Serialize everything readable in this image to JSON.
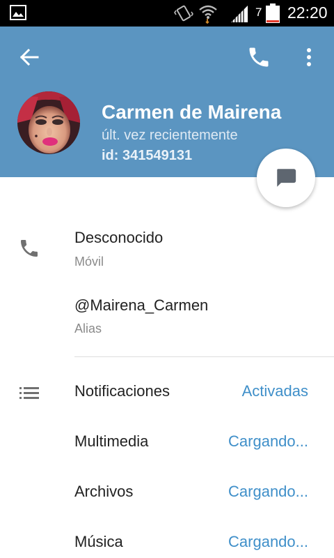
{
  "status_bar": {
    "battery_level": "7",
    "time": "22:20",
    "icons": [
      "gallery-icon",
      "vibrate-icon",
      "wifi-icon",
      "signal-icon",
      "battery-icon"
    ]
  },
  "header": {
    "name": "Carmen de Mairena",
    "status": "últ. vez recientemente",
    "id_text": "id: 341549131",
    "background_color": "#5b95c1",
    "icons": [
      "back-arrow-icon",
      "phone-icon",
      "more-vert-icon",
      "chat-icon"
    ]
  },
  "contact_info": {
    "phone": {
      "value": "Desconocido",
      "label": "Móvil",
      "icon": "phone-icon"
    },
    "username": {
      "value": "@Mairena_Carmen",
      "label": "Alias"
    }
  },
  "settings": {
    "icon": "list-icon",
    "accent_color": "#3f8fc9",
    "items": [
      {
        "label": "Notificaciones",
        "value": "Activadas"
      },
      {
        "label": "Multimedia",
        "value": "Cargando..."
      },
      {
        "label": "Archivos",
        "value": "Cargando..."
      },
      {
        "label": "Música",
        "value": "Cargando..."
      }
    ]
  }
}
